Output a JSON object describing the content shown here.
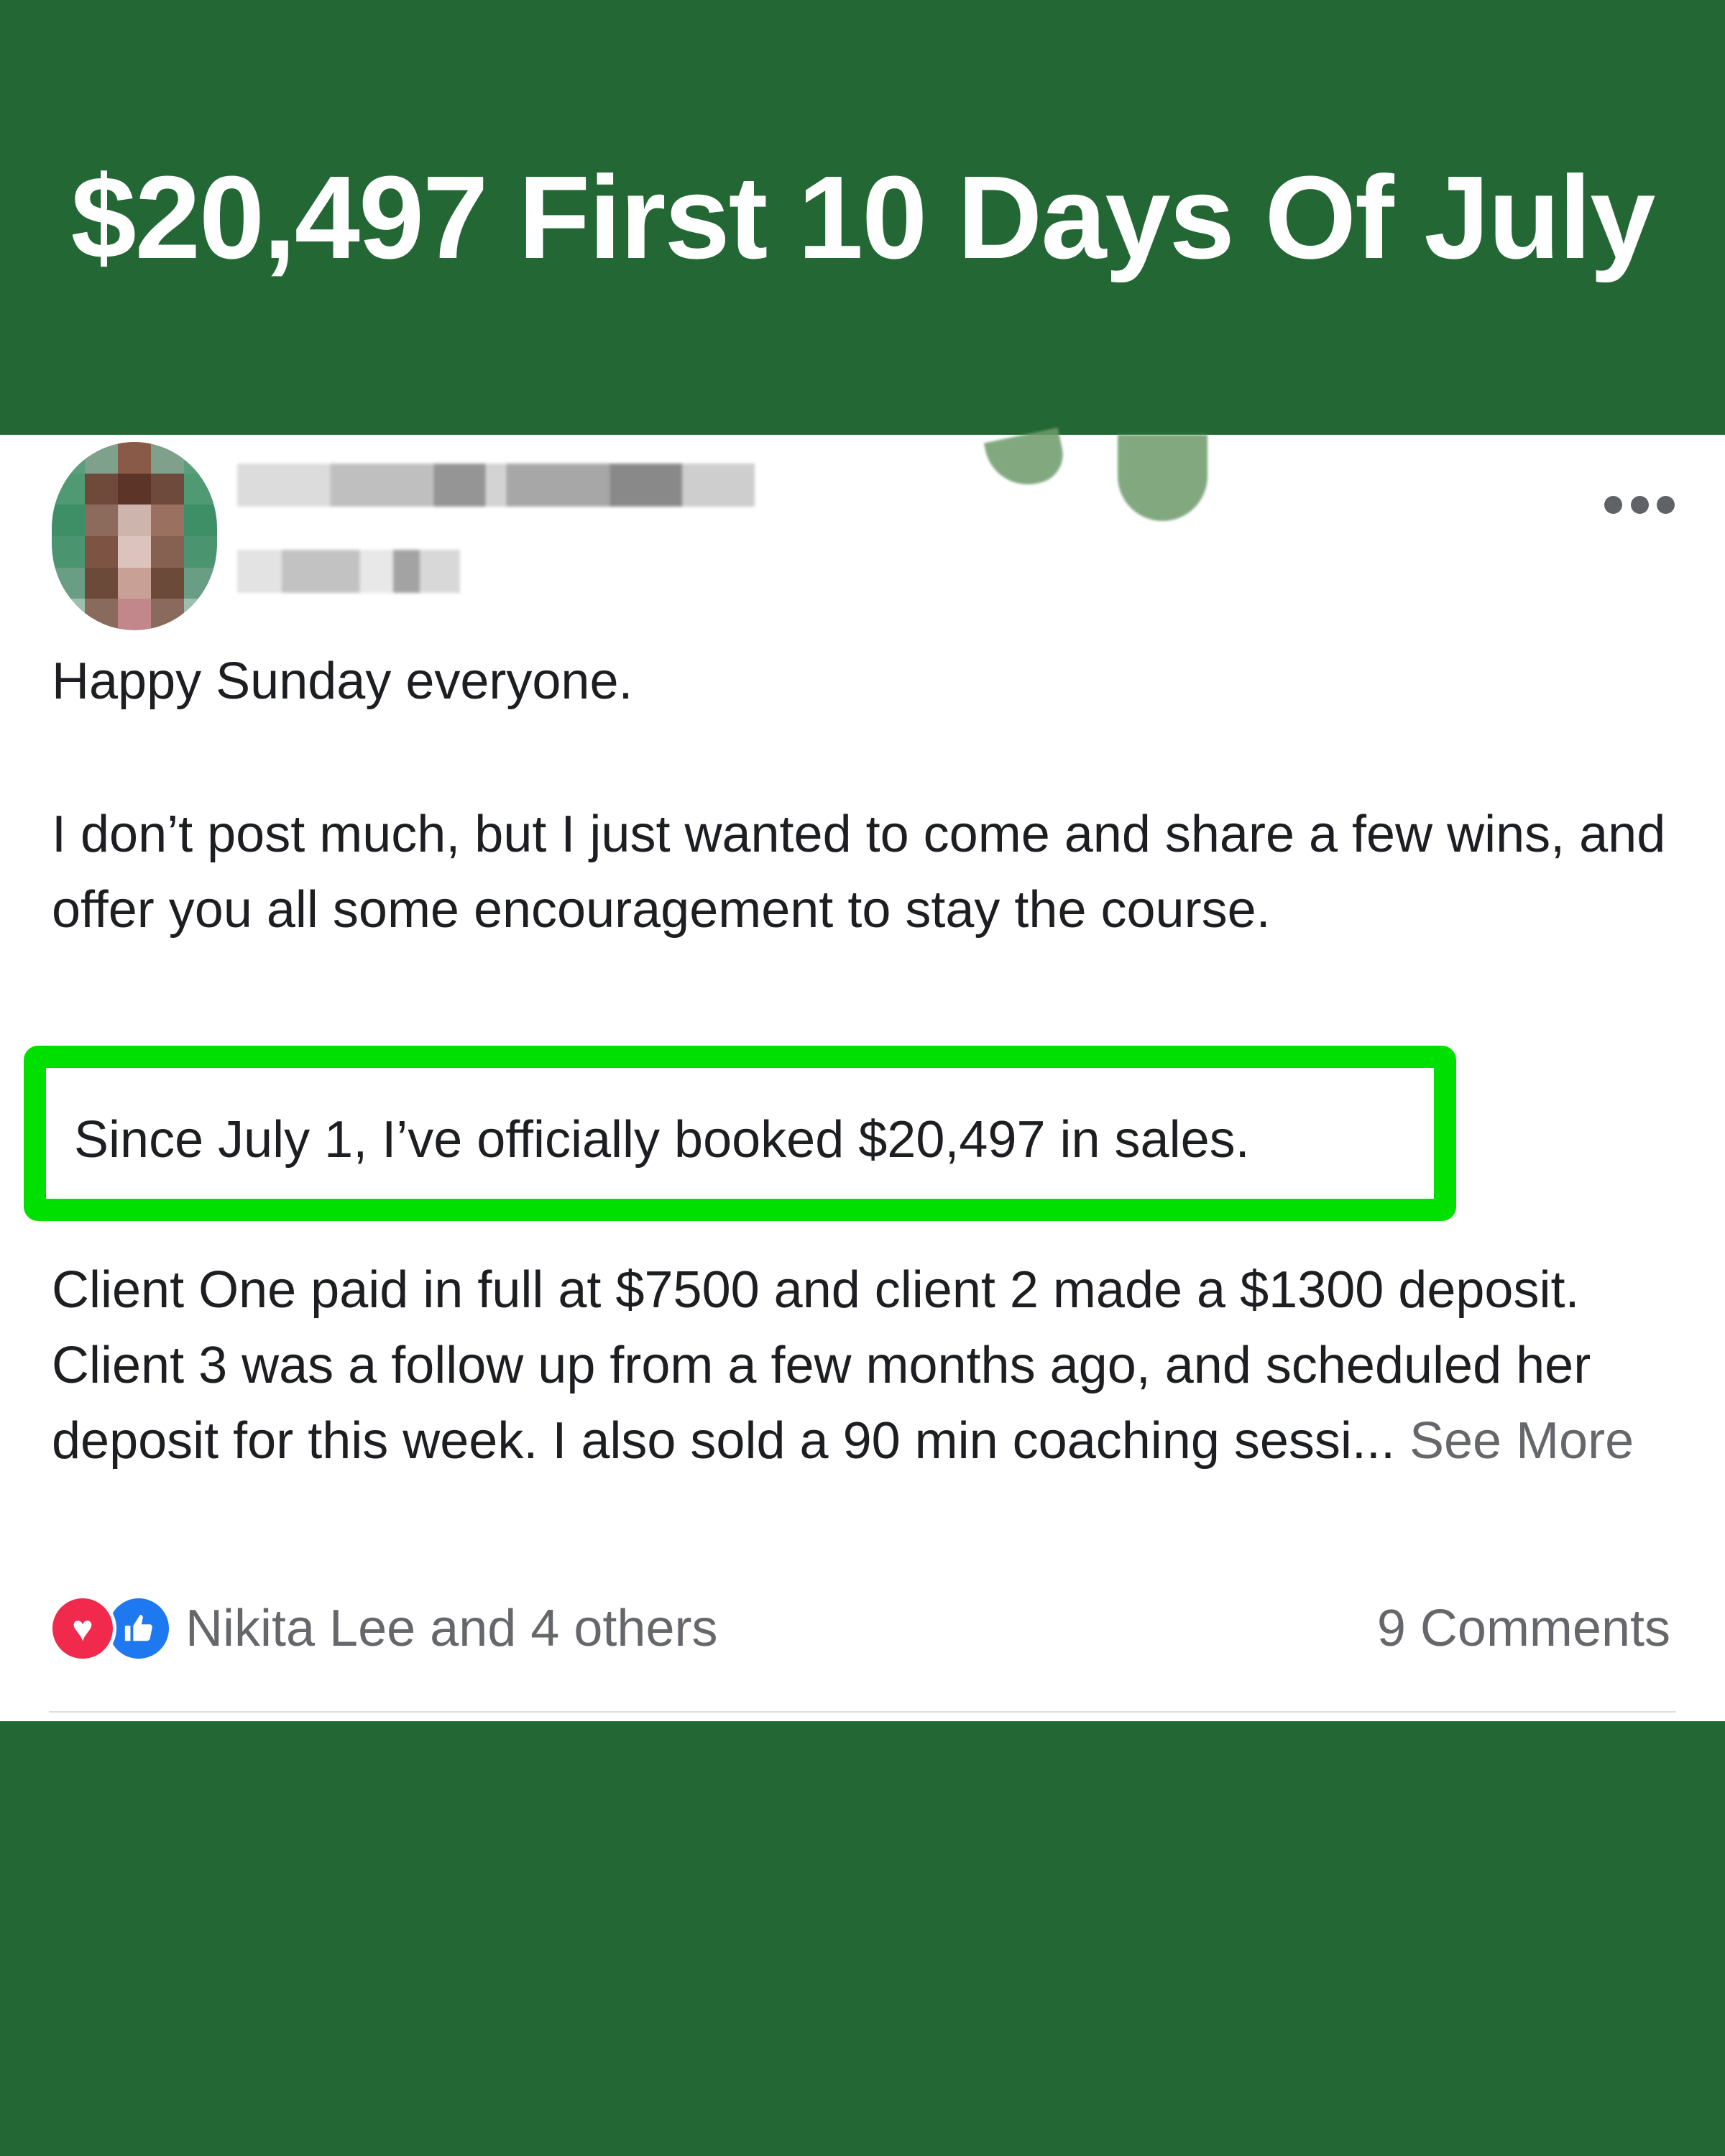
{
  "headline": "$20,497 First 10 Days Of July",
  "post": {
    "paragraph_1": "Happy Sunday everyone.",
    "paragraph_2": "I don’t post much, but I just wanted to come and share a few wins, and offer you all some encouragement to stay the course.",
    "highlighted_text": "Since July 1, I’ve officially booked $20,497 in sales.",
    "paragraph_4": "Client One paid in full at $7500 and client 2 made a $1300 deposit. Client 3 was a follow up from a few months ago, and scheduled her deposit for this week. I also sold a 90 min coaching sessi...",
    "see_more": "See More",
    "reactions_text": "Nikita Lee and 4 others",
    "comments_text": "9 Comments",
    "reaction_icons": [
      "heart-icon",
      "thumbs-up-icon"
    ],
    "more_icon": "more-options-icon"
  },
  "colors": {
    "background_green": "#236834",
    "highlight_green": "#00e000",
    "love_red": "#f0294d",
    "like_blue": "#1e78f0",
    "secondary_text": "#65676b"
  }
}
